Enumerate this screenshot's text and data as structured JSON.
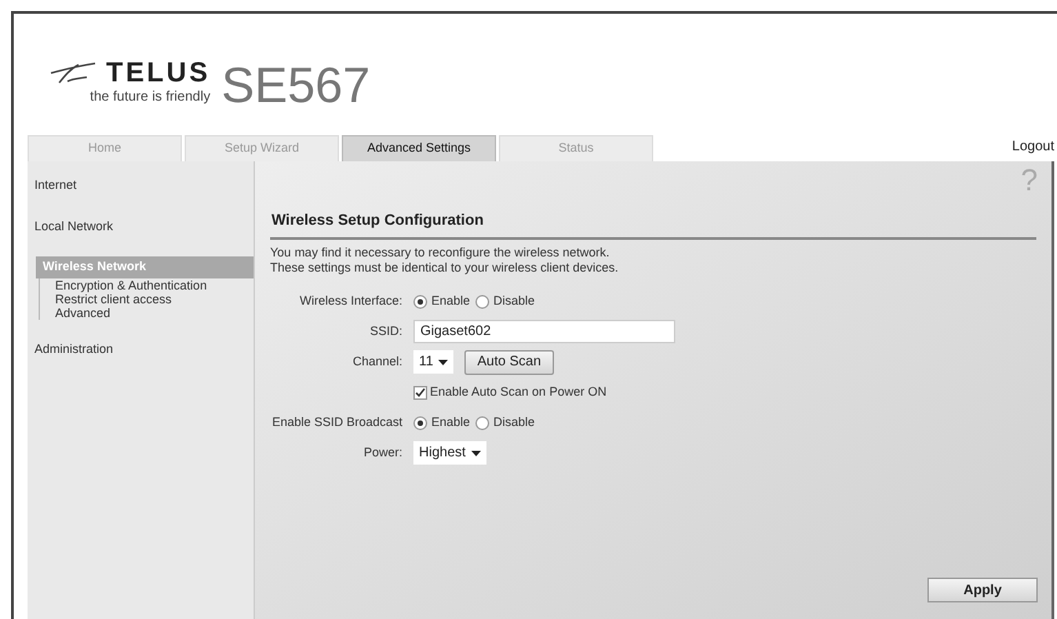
{
  "logo": {
    "brand": "TELUS",
    "tagline": "the future is friendly",
    "model": "SE567"
  },
  "tabs": [
    {
      "label": "Home",
      "selected": false
    },
    {
      "label": "Setup Wizard",
      "selected": false
    },
    {
      "label": "Advanced Settings",
      "selected": true
    },
    {
      "label": "Status",
      "selected": false
    }
  ],
  "logout": "Logout",
  "help": "?",
  "sidebar": {
    "items": [
      {
        "label": "Internet",
        "selected": false
      },
      {
        "label": "Local Network",
        "selected": false
      },
      {
        "label": "Wireless Network",
        "selected": true,
        "children": [
          {
            "label": "Encryption & Authentication"
          },
          {
            "label": "Restrict client access"
          },
          {
            "label": "Advanced"
          }
        ]
      },
      {
        "label": "Administration",
        "selected": false
      }
    ]
  },
  "main": {
    "title": "Wireless Setup Configuration",
    "description": [
      "You may find it necessary to reconfigure the wireless network.",
      "These settings must be identical to your wireless client devices."
    ],
    "rows": [
      {
        "kind": "radio",
        "label": "Wireless Interface:",
        "options": [
          {
            "label": "Enable",
            "selected": true
          },
          {
            "label": "Disable",
            "selected": false
          }
        ]
      },
      {
        "kind": "text",
        "label": "SSID:",
        "value": "Gigaset602"
      },
      {
        "kind": "select",
        "label": "Channel:",
        "value": "11",
        "button": "Auto Scan"
      },
      {
        "kind": "checkbox",
        "label": "Enable Auto Scan on Power ON",
        "checked": true
      },
      {
        "kind": "radio",
        "label": "Enable SSID Broadcast",
        "options": [
          {
            "label": "Enable",
            "selected": true
          },
          {
            "label": "Disable",
            "selected": false
          }
        ]
      },
      {
        "kind": "select",
        "label": "Power:",
        "value": "Highest"
      }
    ],
    "apply": "Apply"
  }
}
